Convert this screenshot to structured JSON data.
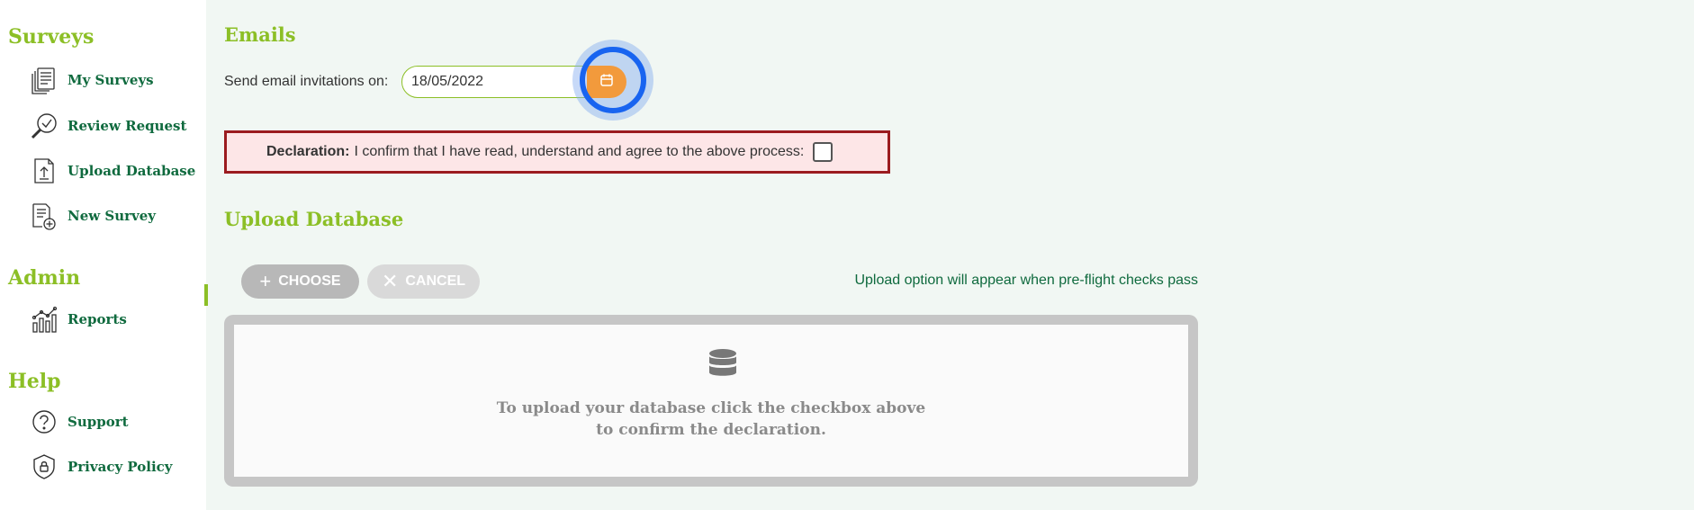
{
  "sidebar": {
    "sections": [
      {
        "title": "Surveys",
        "items": [
          {
            "label": "My Surveys",
            "icon": "documents-icon"
          },
          {
            "label": "Review Request",
            "icon": "search-check-icon"
          },
          {
            "label": "Upload Database",
            "icon": "upload-file-icon"
          },
          {
            "label": "New Survey",
            "icon": "new-document-icon"
          }
        ]
      },
      {
        "title": "Admin",
        "items": [
          {
            "label": "Reports",
            "icon": "chart-icon"
          }
        ]
      },
      {
        "title": "Help",
        "items": [
          {
            "label": "Support",
            "icon": "help-icon"
          },
          {
            "label": "Privacy Policy",
            "icon": "shield-lock-icon"
          }
        ]
      }
    ]
  },
  "emails": {
    "heading": "Emails",
    "send_label": "Send email invitations on:",
    "date_value": "18/05/2022",
    "calendar_icon": "calendar-icon"
  },
  "declaration": {
    "bold_label": "Declaration:",
    "text": "I confirm that I have read, understand and agree to the above process:",
    "checked": false
  },
  "upload": {
    "heading": "Upload Database",
    "choose_label": "CHOOSE",
    "cancel_label": "CANCEL",
    "note": "Upload option will appear when pre-flight checks pass",
    "drop_line1": "To upload your database click the checkbox above",
    "drop_line2": "to confirm the declaration.",
    "drop_icon": "database-icon"
  },
  "colors": {
    "accent_green": "#8cbf26",
    "dark_green": "#0f6a3e",
    "orange": "#f29a3c",
    "focus_blue": "#1864f0",
    "declaration_border": "#9b1b1f"
  }
}
